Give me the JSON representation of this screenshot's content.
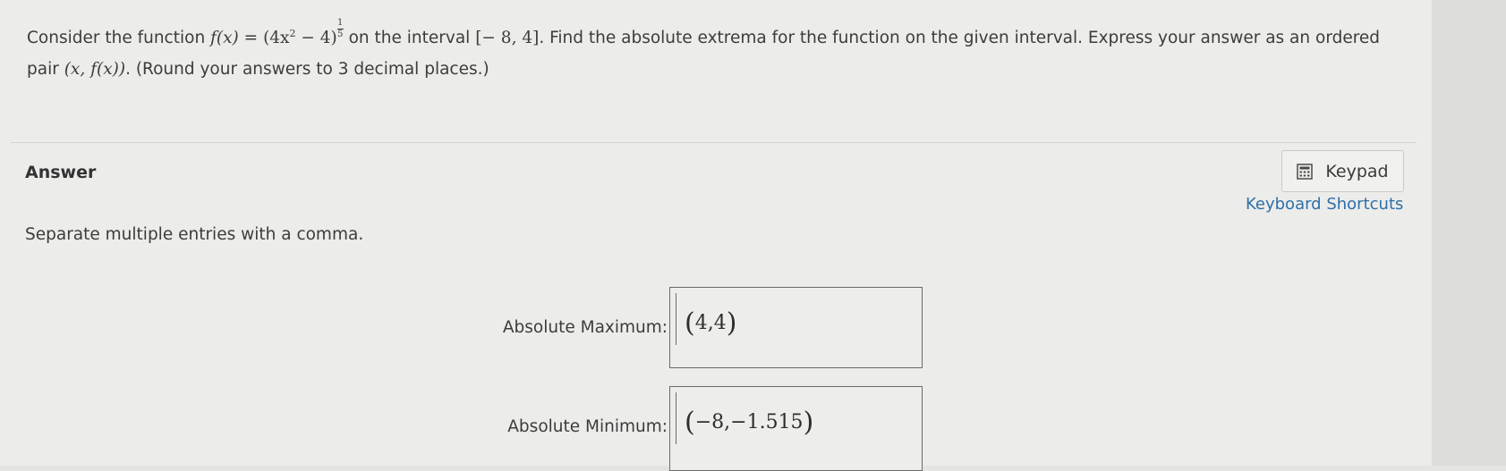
{
  "question": {
    "prefix": "Consider the function ",
    "f_of_x": "f(x)",
    "equals": "=",
    "base": "(4x",
    "base_exp": "2",
    "base_tail": " − 4)",
    "exp_num": "1",
    "exp_den": "5",
    "interval_text": " on the interval ",
    "interval": "[− 8, 4]",
    "rest_line1": ". Find the absolute extrema for the function on the given interval. Express your answer as an ordered",
    "line2_prefix": "pair ",
    "pair": "(x, f(x))",
    "line2_suffix": ". (Round your answers to 3 decimal places.)"
  },
  "answer": {
    "heading": "Answer",
    "keypad_label": "Keypad",
    "keypad_icon": "calculator-icon",
    "shortcuts_label": "Keyboard Shortcuts",
    "hint": "Separate multiple entries with a comma."
  },
  "fields": {
    "max_label": "Absolute Maximum:",
    "max_value": "4,4",
    "min_label": "Absolute Minimum:",
    "min_value": "−8,−1.515"
  },
  "colors": {
    "link": "#2f6fa8",
    "background": "#ececea"
  }
}
